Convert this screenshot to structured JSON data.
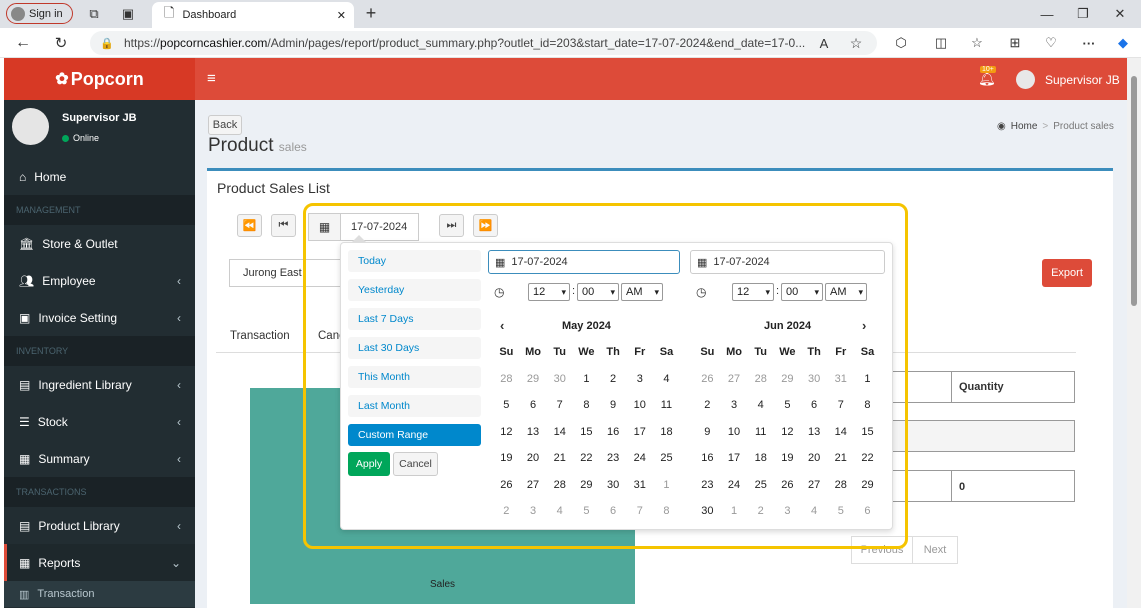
{
  "browser": {
    "signin": "Sign in",
    "tab_title": "Dashboard",
    "url_prefix": "https://",
    "url_domain": "popcorncashier.com",
    "url_rest": "/Admin/pages/report/product_summary.php?outlet_id=203&start_date=17-07-2024&end_date=17-0..."
  },
  "app": {
    "logo": "Popcorn",
    "notif_badge": "10+",
    "user_name": "Supervisor JB",
    "status": "Online",
    "colors": {
      "header": "#dd4b39",
      "logo_bg": "#d73925",
      "sidebar": "#222d32",
      "highlight": "#f5c400"
    }
  },
  "sidebar": {
    "home": "Home",
    "management": "MANAGEMENT",
    "store": "Store & Outlet",
    "employee": "Employee",
    "invoice": "Invoice Setting",
    "inventory": "INVENTORY",
    "ingredient": "Ingredient Library",
    "stock": "Stock",
    "summary": "Summary",
    "transactions": "TRANSACTIONS",
    "product_library": "Product Library",
    "reports": "Reports",
    "transaction": "Transaction"
  },
  "page": {
    "back": "Back",
    "title": "Product",
    "subtitle": "sales",
    "crumb_home": "Home",
    "crumb_sep": ">",
    "crumb_current": "Product sales",
    "box_title": "Product Sales List",
    "date_value": "17-07-2024",
    "outlet": "Jurong East",
    "export": "Export",
    "tab_transaction": "Transaction",
    "tab_cancel": "Canc",
    "col_quantity": "Quantity",
    "cell_zero": "0",
    "prev": "Previous",
    "next": "Next",
    "chart_label": "Sales"
  },
  "datepicker": {
    "ranges": [
      "Today",
      "Yesterday",
      "Last 7 Days",
      "Last 30 Days",
      "This Month",
      "Last Month",
      "Custom Range"
    ],
    "apply": "Apply",
    "cancel": "Cancel",
    "start_input": "17-07-2024",
    "end_input": "17-07-2024",
    "start_time": {
      "hour": "12",
      "minute": "00",
      "ampm": "AM"
    },
    "end_time": {
      "hour": "12",
      "minute": "00",
      "ampm": "AM"
    },
    "time_sep": ":",
    "left_month": "May 2024",
    "right_month": "Jun 2024",
    "weekdays": [
      "Su",
      "Mo",
      "Tu",
      "We",
      "Th",
      "Fr",
      "Sa"
    ],
    "left_days": [
      [
        "28",
        "29",
        "30",
        "1",
        "2",
        "3",
        "4"
      ],
      [
        "5",
        "6",
        "7",
        "8",
        "9",
        "10",
        "11"
      ],
      [
        "12",
        "13",
        "14",
        "15",
        "16",
        "17",
        "18"
      ],
      [
        "19",
        "20",
        "21",
        "22",
        "23",
        "24",
        "25"
      ],
      [
        "26",
        "27",
        "28",
        "29",
        "30",
        "31",
        "1"
      ],
      [
        "2",
        "3",
        "4",
        "5",
        "6",
        "7",
        "8"
      ]
    ],
    "right_days": [
      [
        "26",
        "27",
        "28",
        "29",
        "30",
        "31",
        "1"
      ],
      [
        "2",
        "3",
        "4",
        "5",
        "6",
        "7",
        "8"
      ],
      [
        "9",
        "10",
        "11",
        "12",
        "13",
        "14",
        "15"
      ],
      [
        "16",
        "17",
        "18",
        "19",
        "20",
        "21",
        "22"
      ],
      [
        "23",
        "24",
        "25",
        "26",
        "27",
        "28",
        "29"
      ],
      [
        "30",
        "1",
        "2",
        "3",
        "4",
        "5",
        "6"
      ]
    ]
  }
}
